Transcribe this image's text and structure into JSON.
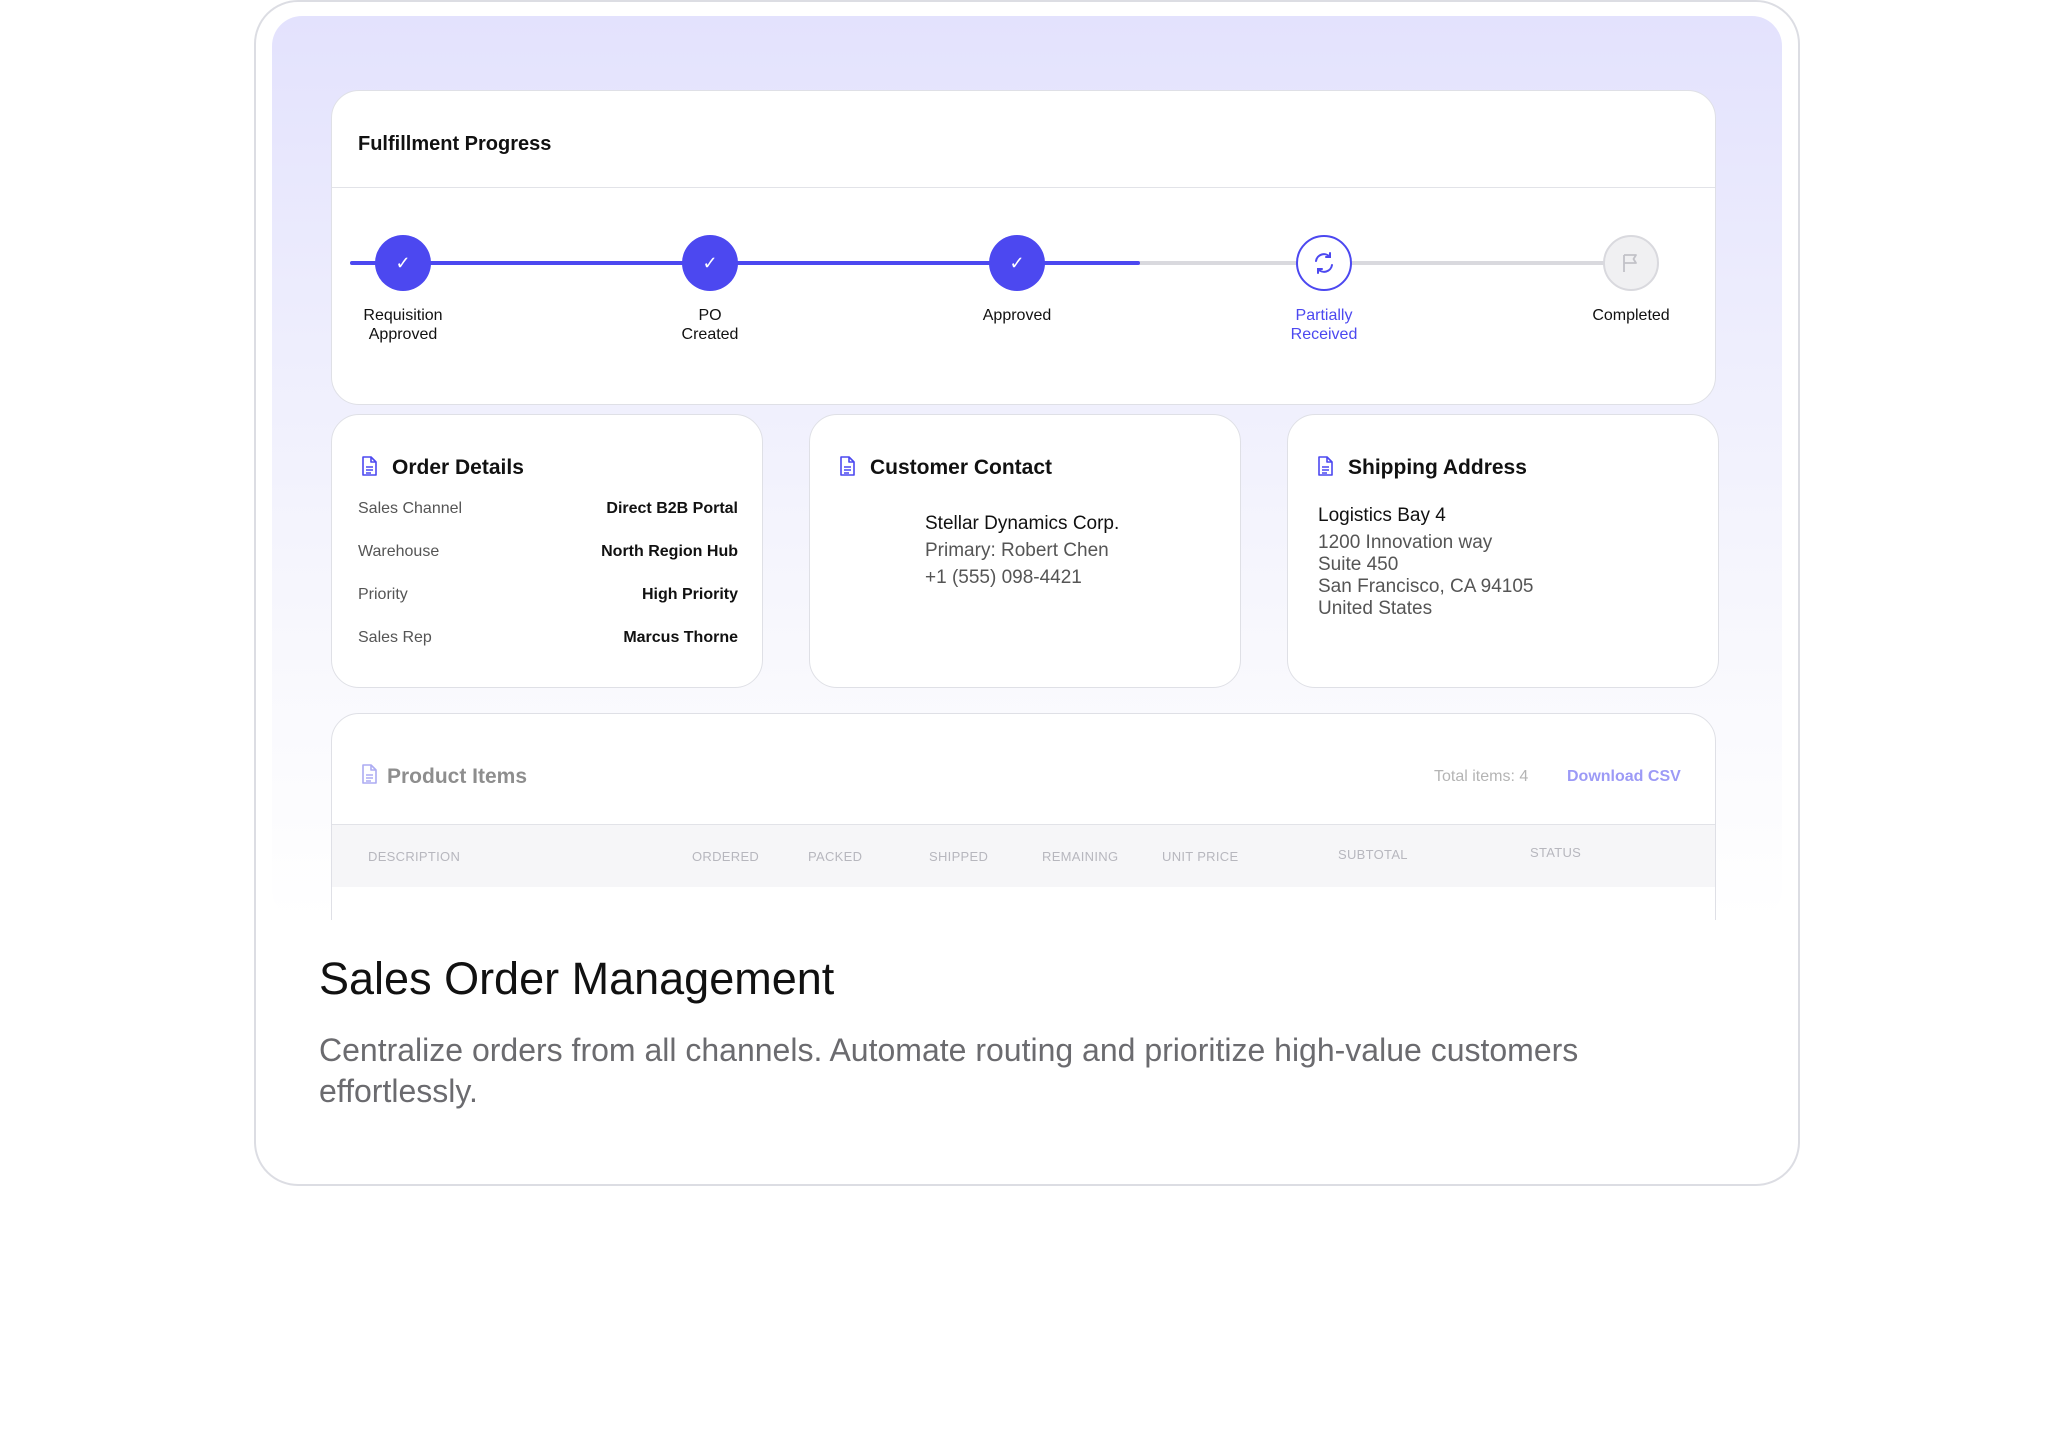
{
  "progress": {
    "title": "Fulfillment Progress",
    "steps": [
      {
        "label_line1": "Requisition",
        "label_line2": "Approved",
        "state": "done"
      },
      {
        "label_line1": "PO",
        "label_line2": "Created",
        "state": "done"
      },
      {
        "label_line1": "Approved",
        "label_line2": "",
        "state": "done"
      },
      {
        "label_line1": "Partially",
        "label_line2": "Received",
        "state": "current"
      },
      {
        "label_line1": "Completed",
        "label_line2": "",
        "state": "pending"
      }
    ],
    "check_glyph": "✓",
    "accent_color": "#4c48f0",
    "track_color": "#d9d9de"
  },
  "order_details": {
    "title": "Order Details",
    "icon": "document-icon",
    "rows": [
      {
        "key": "Sales Channel",
        "value": "Direct B2B Portal"
      },
      {
        "key": "Warehouse",
        "value": "North Region Hub"
      },
      {
        "key": "Priority",
        "value": "High Priority"
      },
      {
        "key": "Sales Rep",
        "value": "Marcus Thorne"
      }
    ]
  },
  "customer_contact": {
    "title": "Customer Contact",
    "icon": "document-icon",
    "company": "Stellar Dynamics Corp.",
    "primary": "Primary: Robert Chen",
    "phone": "+1 (555) 098-4421"
  },
  "shipping_address": {
    "title": "Shipping Address",
    "icon": "document-icon",
    "name": "Logistics Bay 4",
    "line1": "1200 Innovation way",
    "line2": "Suite 450",
    "line3": "San Francisco, CA 94105",
    "line4": "United States"
  },
  "product_items": {
    "title": "Product Items",
    "icon": "document-icon",
    "total_label": "Total items: 4",
    "download_label": "Download CSV",
    "columns": [
      "DESCRIPTION",
      "ORDERED",
      "PACKED",
      "SHIPPED",
      "REMAINING",
      "UNIT PRICE",
      "SUBTOTAL",
      "STATUS"
    ]
  },
  "marketing": {
    "headline": "Sales Order Management",
    "description": "Centralize orders from all channels. Automate routing and prioritize high-value customers effortlessly."
  }
}
